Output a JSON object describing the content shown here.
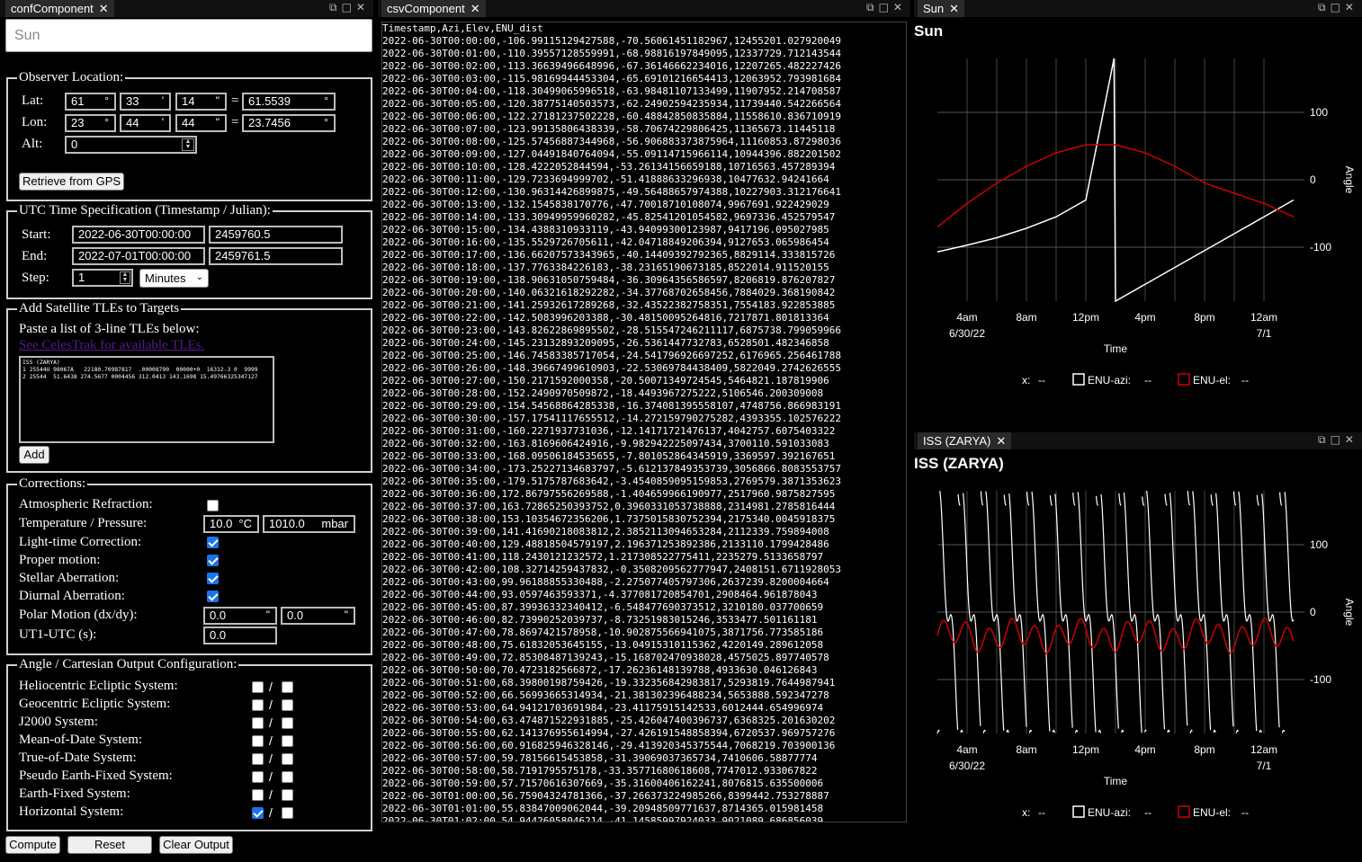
{
  "conf": {
    "tab": "confComponent",
    "target": "Sun",
    "observer": {
      "legend": "Observer Location:",
      "lat_label": "Lat:",
      "lat_deg": "61",
      "lat_min": "33",
      "lat_sec": "14",
      "lat_dec": "61.5539",
      "lon_label": "Lon:",
      "lon_deg": "23",
      "lon_min": "44",
      "lon_sec": "44",
      "lon_dec": "23.7456",
      "alt_label": "Alt:",
      "alt": "0",
      "gps_button": "Retrieve from GPS",
      "deg_sym": "°",
      "min_sym": "'",
      "sec_sym": "\"",
      "eq": "="
    },
    "time": {
      "legend": "UTC Time Specification (Timestamp / Julian):",
      "start_label": "Start:",
      "start": "2022-06-30T00:00:00",
      "start_jd": "2459760.5",
      "end_label": "End:",
      "end": "2022-07-01T00:00:00",
      "end_jd": "2459761.5",
      "step_label": "Step:",
      "step": "1",
      "step_unit": "Minutes"
    },
    "tle": {
      "legend": "Add Satellite TLEs to Targets",
      "instruction": "Paste a list of 3-line TLEs below:",
      "link": "See CelesTrak for available TLEs.",
      "text": "ISS (ZARYA)\n1 25544U 98067A   22180.70987817  .00008790  00000+0  16312-3 0  9999\n2 25544  51.6438 274.5677 0004456 312.0413 143.1698 15.49766325347127",
      "add_button": "Add"
    },
    "corrections": {
      "legend": "Corrections:",
      "refraction": "Atmospheric Refraction:",
      "temp_pressure": "Temperature / Pressure:",
      "temp": "10.0",
      "temp_unit": "°C",
      "pressure": "1010.0",
      "pressure_unit": "mbar",
      "light_time": "Light-time Correction:",
      "proper_motion": "Proper motion:",
      "stellar": "Stellar Aberration:",
      "diurnal": "Diurnal Aberration:",
      "polar": "Polar Motion (dx/dy):",
      "dx": "0.0",
      "dy": "0.0",
      "arcsec": "\"",
      "ut1": "UT1-UTC (s):",
      "ut1_val": "0.0"
    },
    "output": {
      "legend": "Angle / Cartesian Output Configuration:",
      "systems": [
        {
          "label": "Heliocentric Ecliptic System:",
          "angle": false,
          "cart": false
        },
        {
          "label": "Geocentric Ecliptic System:",
          "angle": false,
          "cart": false
        },
        {
          "label": "J2000 System:",
          "angle": false,
          "cart": false
        },
        {
          "label": "Mean-of-Date System:",
          "angle": false,
          "cart": false
        },
        {
          "label": "True-of-Date System:",
          "angle": false,
          "cart": false
        },
        {
          "label": "Pseudo Earth-Fixed System:",
          "angle": false,
          "cart": false
        },
        {
          "label": "Earth-Fixed System:",
          "angle": false,
          "cart": false
        },
        {
          "label": "Horizontal System:",
          "angle": true,
          "cart": false
        }
      ],
      "slash": "/"
    },
    "buttons": {
      "compute": "Compute",
      "reset": "Reset",
      "clear": "Clear Output"
    }
  },
  "csv": {
    "tab": "csvComponent",
    "header": "Timestamp,Azi,Elev,ENU_dist",
    "rows": [
      "2022-06-30T00:00:00,-106.99115129427588,-70.56061451182967,12455201.027920049",
      "2022-06-30T00:01:00,-110.39557128559991,-68.98816197849095,12337729.712143544",
      "2022-06-30T00:02:00,-113.36639496648996,-67.36146662234016,12207265.482227426",
      "2022-06-30T00:03:00,-115.98169944453304,-65.69101216654413,12063952.793981684",
      "2022-06-30T00:04:00,-118.30499065996518,-63.98481107133499,11907952.214708587",
      "2022-06-30T00:05:00,-120.38775140503573,-62.24902594235934,11739440.542266564",
      "2022-06-30T00:06:00,-122.27181237502228,-60.48842850835884,11558610.836710919",
      "2022-06-30T00:07:00,-123.99135806438339,-58.70674229806425,11365673.11445118",
      "2022-06-30T00:08:00,-125.57456887344968,-56.906883373875964,11160853.87298036",
      "2022-06-30T00:09:00,-127.04491840764094,-55.09114715966114,10944396.882201502",
      "2022-06-30T00:10:00,-128.4222052844594,-53.26134156659188,10716563.457289394",
      "2022-06-30T00:11:00,-129.7233694999702,-51.41888633296938,10477632.94241664",
      "2022-06-30T00:12:00,-130.96314426899875,-49.56488657974388,10227903.312176641",
      "2022-06-30T00:13:00,-132.1545838170776,-47.70018710108074,9967691.922429029",
      "2022-06-30T00:14:00,-133.30949959960282,-45.82541201054582,9697336.452579547",
      "2022-06-30T00:15:00,-134.4388310933119,-43.94099300123987,9417196.095027985",
      "2022-06-30T00:16:00,-135.5529726705611,-42.04718849206394,9127653.065986454",
      "2022-06-30T00:17:00,-136.66207573343965,-40.14409392792365,8829114.333815726",
      "2022-06-30T00:18:00,-137.7763384226183,-38.23165190673185,8522014.911520155",
      "2022-06-30T00:19:00,-138.90631050759484,-36.30964356586597,8206819.876207827",
      "2022-06-30T00:20:00,-140.06321618292282,-34.37768702658456,7884029.368190842",
      "2022-06-30T00:21:00,-141.25932617289268,-32.43522382758351,7554183.922853885",
      "2022-06-30T00:22:00,-142.5083996203388,-30.48150095264816,7217871.801813364",
      "2022-06-30T00:23:00,-143.82622869895502,-28.515547246211117,6875738.799059966",
      "2022-06-30T00:24:00,-145.23132893209095,-26.5361447732783,6528501.482346858",
      "2022-06-30T00:25:00,-146.74583385717054,-24.541796926697252,6176965.256461788",
      "2022-06-30T00:26:00,-148.39667499610903,-22.53069784438409,5822049.2742626555",
      "2022-06-30T00:27:00,-150.2171592000358,-20.50071349724545,5464821.187819906",
      "2022-06-30T00:28:00,-152.2490970509872,-18.4493967275222,5106546.200309008",
      "2022-06-30T00:29:00,-154.54568864285338,-16.374081395558107,4748756.866983191",
      "2022-06-30T00:30:00,-157.17541117655512,-14.272159790275282,4393355.102576222",
      "2022-06-30T00:31:00,-160.2271937731036,-12.14171721476137,4042757.6075403322",
      "2022-06-30T00:32:00,-163.8169606424916,-9.982942225097434,3700110.591033083",
      "2022-06-30T00:33:00,-168.09506184535655,-7.801052864345919,3369597.392167651",
      "2022-06-30T00:34:00,-173.25227134683797,-5.612137849353739,3056866.8083553757",
      "2022-06-30T00:35:00,-179.5175787683642,-3.4540859095159853,2769579.3871353623",
      "2022-06-30T00:36:00,172.86797556269588,-1.404659966190977,2517960.9875827595",
      "2022-06-30T00:37:00,163.72865250393752,0.3960331053738888,2314981.2785816444",
      "2022-06-30T00:38:00,153.10354672356206,1.7375015830752394,2175340.0045918375",
      "2022-06-30T00:39:00,141.41690218083812,2.3852113094653284,2112339.759894008",
      "2022-06-30T00:40:00,129.48818504579197,2.196371253892386,2133110.1799428486",
      "2022-06-30T00:41:00,118.2430121232572,1.217308522775411,2235279.5133658797",
      "2022-06-30T00:42:00,108.32714259437832,-0.3508209562777947,2408151.6711928053",
      "2022-06-30T00:43:00,99.96188855330488,-2.275077405797306,2637239.8200004664",
      "2022-06-30T00:44:00,93.0597463593371,-4.377081720854701,2908464.961878043",
      "2022-06-30T00:45:00,87.39936332340412,-6.548477690373512,3210180.037700659",
      "2022-06-30T00:46:00,82.73990252039737,-8.73251983015246,3533477.501161181",
      "2022-06-30T00:47:00,78.8697421578958,-10.902875566941075,3871756.773585186",
      "2022-06-30T00:48:00,75.61832053645155,-13.04915310115362,4220149.289612058",
      "2022-06-30T00:49:00,72.85308487139243,-15.168702470938028,4575025.897740578",
      "2022-06-30T00:50:00,70.4723182566872,-17.26236148139788,4933630.046126843",
      "2022-06-30T00:51:00,68.39800198759426,-19.332356842983817,5293819.7644987941",
      "2022-06-30T00:52:00,66.56993665314934,-21.381302396488234,5653888.592347278",
      "2022-06-30T00:53:00,64.94121703691984,-23.41175915142533,6012444.654996974",
      "2022-06-30T00:54:00,63.474871522931885,-25.426047400396737,6368325.201630202",
      "2022-06-30T00:55:00,62.141376955614994,-27.426191548858394,6720537.969757276",
      "2022-06-30T00:56:00,60.916825946328146,-29.413920345375544,7068219.703900136",
      "2022-06-30T00:57:00,59.78156615453858,-31.39069037365734,7410606.58877774",
      "2022-06-30T00:58:00,58.7191795575178,-33.35771680618608,7747012.933067822",
      "2022-06-30T00:59:00,57.71570616307669,-35.31600406162241,8076815.635500006",
      "2022-06-30T01:00:00,56.75904324781366,-37.266373224985266,8399442.753278887",
      "2022-06-30T01:01:00,55.83847009062044,-39.20948509771637,8714365.015981458",
      "2022-06-30T01:02:00,54.94426058046214,-41.14585997924033,9021089.686856039"
    ]
  },
  "charts": [
    {
      "tab": "Sun",
      "title": "Sun",
      "ylabel": "Angle",
      "xlabel": "Time",
      "legend_x": "x:",
      "legend_x_val": "--",
      "legend_azi": "ENU-azi:",
      "legend_azi_val": "--",
      "legend_el": "ENU-el:",
      "legend_el_val": "--"
    },
    {
      "tab": "ISS (ZARYA)",
      "title": "ISS (ZARYA)",
      "ylabel": "Angle",
      "xlabel": "Time",
      "legend_x": "x:",
      "legend_x_val": "--",
      "legend_azi": "ENU-azi:",
      "legend_azi_val": "--",
      "legend_el": "ENU-el:",
      "legend_el_val": "--"
    }
  ],
  "chart_data": [
    {
      "type": "line",
      "title": "Sun",
      "xlabel": "Time",
      "ylabel": "Angle",
      "x_ticks": [
        "4am",
        "8am",
        "12pm",
        "4pm",
        "8pm",
        "12am"
      ],
      "x_sublabels": [
        "6/30/22",
        "7/1"
      ],
      "y_ticks": [
        100,
        0,
        -100
      ],
      "ylim": [
        -180,
        180
      ],
      "xlim_hours": [
        2,
        26
      ],
      "series": [
        {
          "name": "ENU-azi",
          "color": "#ffffff",
          "x": [
            0,
            2,
            4,
            6,
            8,
            10,
            11.9,
            12.0,
            14,
            16,
            18,
            20,
            22,
            24
          ],
          "y": [
            -107,
            -97,
            -86,
            -72,
            -55,
            -30,
            180,
            -180,
            -155,
            -130,
            -105,
            -80,
            -55,
            -30
          ]
        },
        {
          "name": "ENU-el",
          "color": "#cc0000",
          "x": [
            0,
            2,
            4,
            6,
            8,
            10,
            12,
            14,
            16,
            18,
            20,
            22,
            24
          ],
          "y": [
            -70,
            -35,
            -5,
            20,
            40,
            52,
            52,
            40,
            20,
            -5,
            -20,
            -35,
            -55
          ]
        }
      ]
    },
    {
      "type": "line",
      "title": "ISS (ZARYA)",
      "xlabel": "Time",
      "ylabel": "Angle",
      "x_ticks": [
        "4am",
        "8am",
        "12pm",
        "4pm",
        "8pm",
        "12am"
      ],
      "x_sublabels": [
        "6/30/22",
        "7/1"
      ],
      "y_ticks": [
        100,
        0,
        -100
      ],
      "ylim": [
        -180,
        180
      ],
      "xlim_hours": [
        2,
        26
      ],
      "orbit_period_min": 92.9,
      "series": [
        {
          "name": "ENU-azi",
          "color": "#ffffff"
        },
        {
          "name": "ENU-el",
          "color": "#cc0000"
        }
      ]
    }
  ]
}
